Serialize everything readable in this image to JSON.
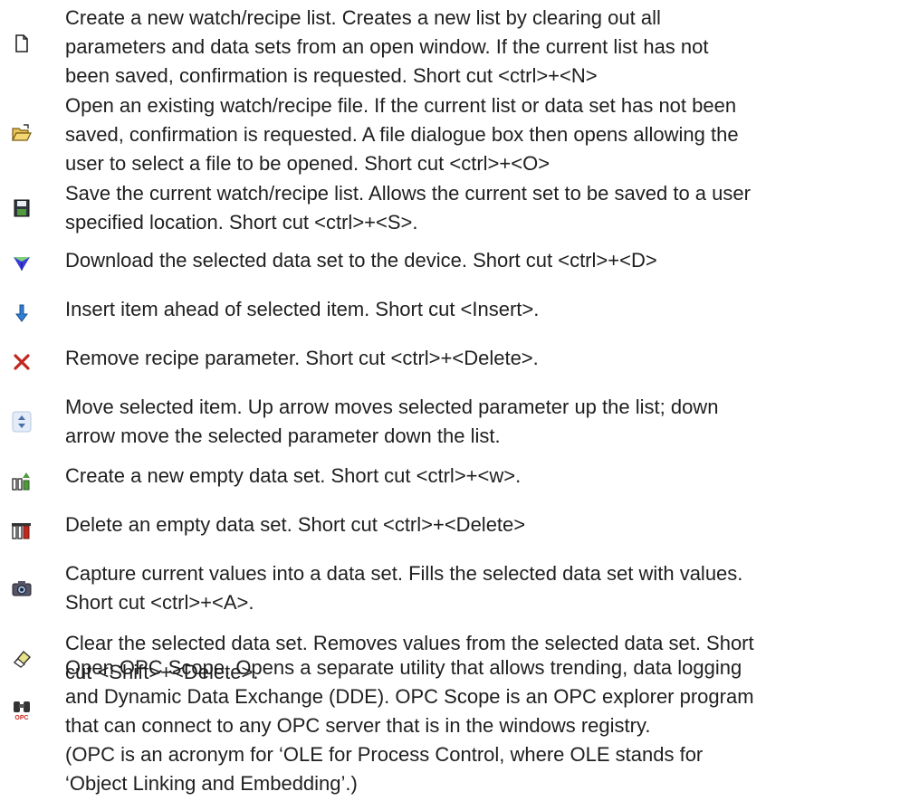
{
  "items": [
    {
      "icon": "new-document-icon",
      "text": "Create a new watch/recipe list. Creates a new list by clearing out all\nparameters and data sets from an open window. If the current list has not\nbeen saved, confirmation is requested. Short cut <ctrl>+<N>"
    },
    {
      "icon": "open-folder-icon",
      "text": "Open an existing watch/recipe file. If the current list or data set has not been\nsaved, confirmation is requested. A file dialogue box then opens allowing the\nuser to select a file to be opened. Short cut <ctrl>+<O>"
    },
    {
      "icon": "save-floppy-icon",
      "text": "Save the current watch/recipe list. Allows the current set to be saved to a user\nspecified location. Short cut <ctrl>+<S>."
    },
    {
      "icon": "download-icon",
      "text": "Download the selected data set to the device. Short cut <ctrl>+<D>"
    },
    {
      "icon": "insert-arrow-down-icon",
      "text": "Insert item ahead of selected item. Short cut <Insert>."
    },
    {
      "icon": "remove-x-icon",
      "text": "Remove recipe parameter. Short cut <ctrl>+<Delete>."
    },
    {
      "icon": "move-up-down-icon",
      "text": "Move selected item. Up arrow moves selected parameter up the list; down\narrow move the selected parameter down the list."
    },
    {
      "icon": "new-data-set-icon",
      "text": "Create a new empty data set. Short cut <ctrl>+<w>."
    },
    {
      "icon": "delete-data-set-icon",
      "text": "Delete an empty data set. Short cut <ctrl>+<Delete>"
    },
    {
      "icon": "capture-camera-icon",
      "text": "Capture current values into a data set. Fills the selected data set with values.\nShort cut <ctrl>+<A>."
    },
    {
      "icon": "clear-eraser-icon",
      "text": "Clear the selected data set. Removes values from the selected data set. Short\ncut <Shift>+<Delete>."
    },
    {
      "icon": "opc-scope-binoculars-icon",
      "text": "Open OPC Scope. Opens a separate utility that allows trending, data logging\nand Dynamic Data Exchange (DDE). OPC Scope is an OPC explorer program\nthat can connect to any OPC server that is in the windows registry.\n(OPC is an acronym for ‘OLE for Process Control, where OLE stands for\n‘Object Linking and Embedding’.)"
    }
  ]
}
